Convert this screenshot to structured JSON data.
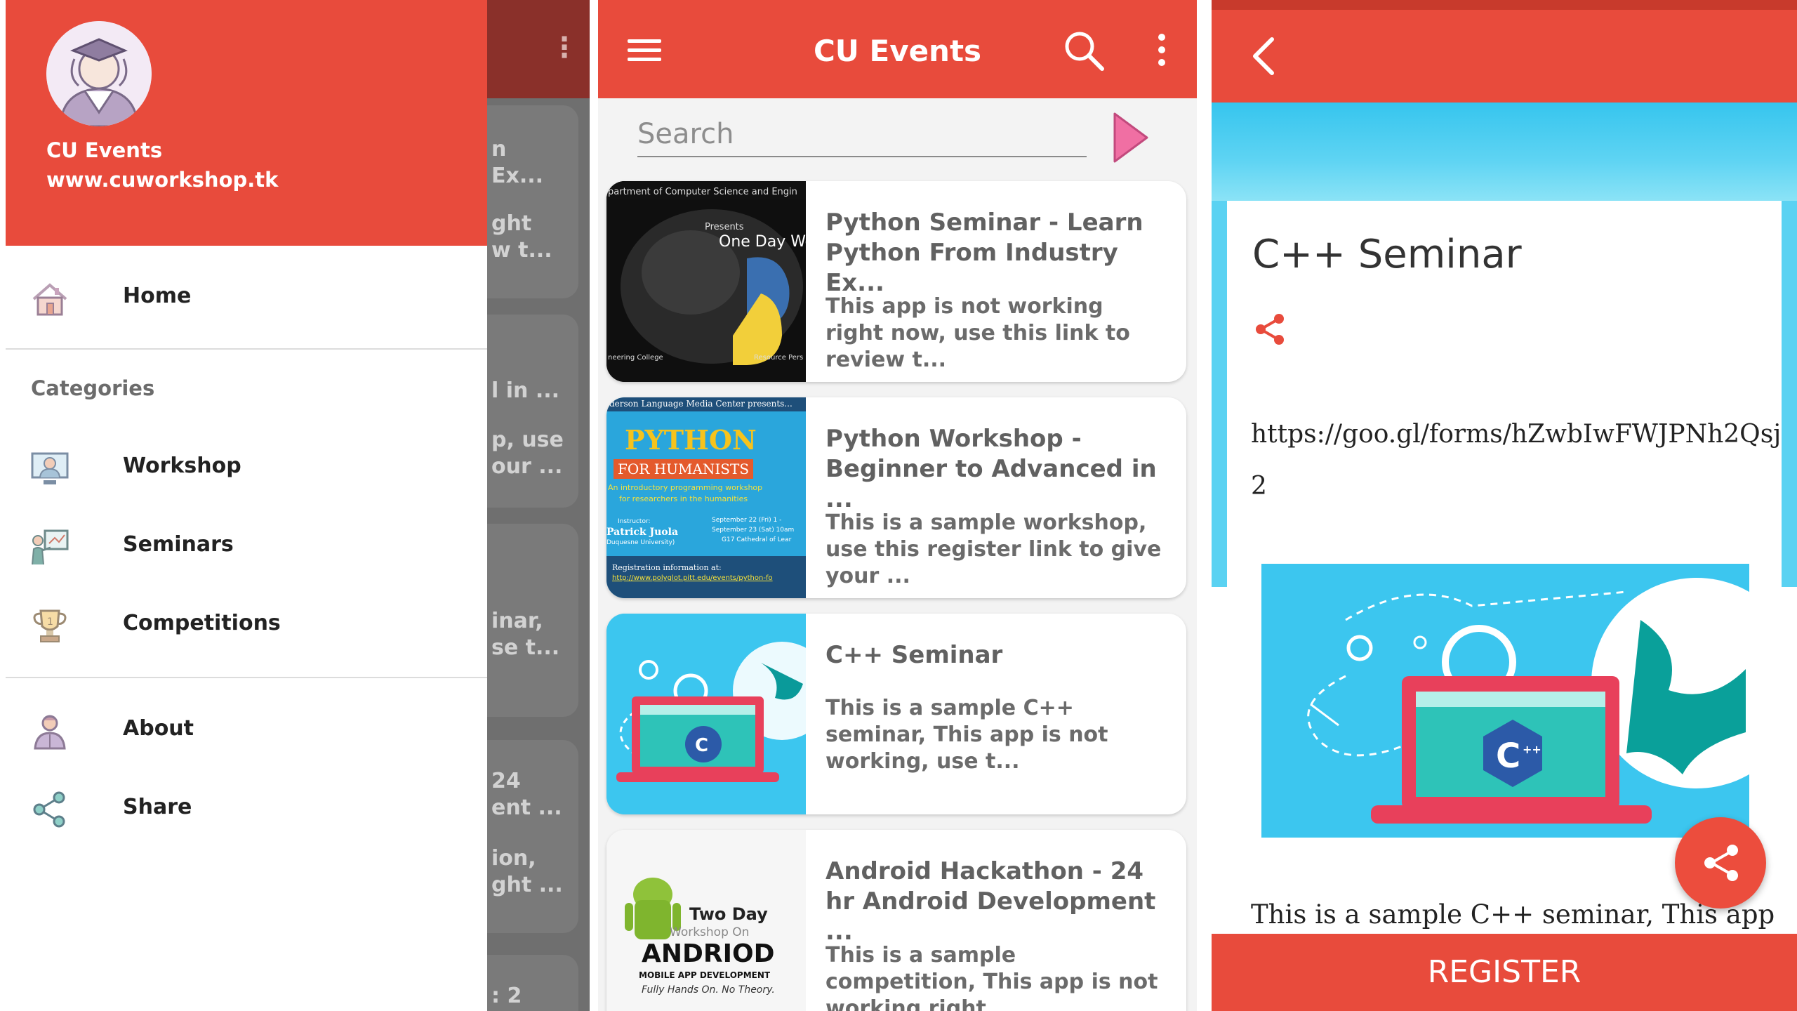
{
  "drawer_screen": {
    "app_name": "CU Events",
    "website": "www.cuworkshop.tk",
    "home_label": "Home",
    "categories_heading": "Categories",
    "category_items": [
      {
        "label": "Workshop",
        "icon": "presentation-board-icon"
      },
      {
        "label": "Seminars",
        "icon": "teacher-board-icon"
      },
      {
        "label": "Competitions",
        "icon": "trophy-icon"
      }
    ],
    "other_items": [
      {
        "label": "About",
        "icon": "person-icon"
      },
      {
        "label": "Share",
        "icon": "share-icon"
      }
    ],
    "background_fragments": [
      "n\nEx...",
      "ght\nw t...",
      "l in ...",
      "p, use\nour ...",
      "inar,\nse t...",
      "24\nent ...",
      "ion,\nght ...",
      ": 2"
    ]
  },
  "list_screen": {
    "title": "CU Events",
    "search_placeholder": "Search",
    "events": [
      {
        "title": "Python Seminar - Learn Python From Industry Ex...",
        "description": "This app is not working right now, use this link to review t...",
        "thumb_caption": "partment of Computer Science and Engin",
        "thumb_presents": "Presents",
        "thumb_headline": "One Day Wo",
        "thumb_footer_left": "neering College",
        "thumb_footer_right": "Resource Pers"
      },
      {
        "title": "Python Workshop - Beginner to Advanced in ...",
        "description": "This is a sample workshop, use this register link to give your ...",
        "thumb_caption": "derson Language Media Center presents...",
        "thumb_headline": "PYTHON",
        "thumb_subhead": "FOR HUMANISTS",
        "thumb_line1": "An introductory programming workshop",
        "thumb_line2": "for researchers in the humanities",
        "thumb_instructor_label": "Instructor:",
        "thumb_instructor": "Patrick Juola",
        "thumb_instructor_org": "Duquesne University)",
        "thumb_dates1": "September 22 (Fri) 1 -",
        "thumb_dates2": "September 23 (Sat) 10am",
        "thumb_dates3": "G17 Cathedral of Lear",
        "thumb_reg_label": "Registration information at:",
        "thumb_reg_url": "http://www.polyglot.pitt.edu/events/python-fo"
      },
      {
        "title": "C++ Seminar",
        "description": "This is a sample C++ seminar, This app is not working, use t..."
      },
      {
        "title": "Android Hackathon - 24 hr Android Development ...",
        "description": "This is a sample competition, This app is not working right ...",
        "thumb_line1": "Two Day",
        "thumb_line2": "Workshop On",
        "thumb_headline": "ANDRIOD",
        "thumb_line3": "MOBILE APP DEVELOPMENT",
        "thumb_line4": "Fully Hands On. No Theory."
      }
    ]
  },
  "detail_screen": {
    "title": "C++ Seminar",
    "link": "https://goo.gl/forms/hZwbIwFWJPNh2Qsj2",
    "description": "This is a sample C++ seminar, This app",
    "register_label": "REGISTER"
  },
  "colors": {
    "primary": "#e84b3c",
    "primary_dark": "#c83a2c",
    "banner_blue": "#3cc6ef"
  }
}
